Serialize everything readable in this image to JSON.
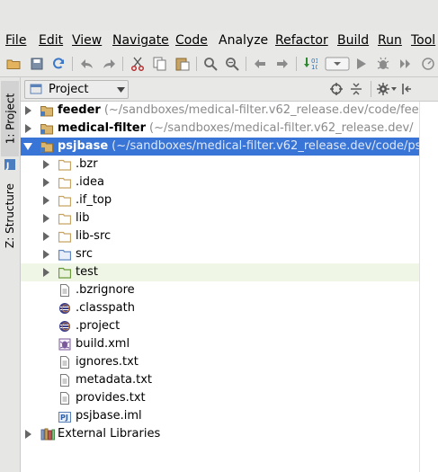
{
  "menu": [
    {
      "label": "File",
      "key": "file"
    },
    {
      "label": "Edit",
      "key": "edit"
    },
    {
      "label": "View",
      "key": "view"
    },
    {
      "label": "Navigate",
      "key": "navigate"
    },
    {
      "label": "Code",
      "key": "code"
    },
    {
      "label": "Analyze",
      "key": "analyze"
    },
    {
      "label": "Refactor",
      "key": "refactor"
    },
    {
      "label": "Build",
      "key": "build"
    },
    {
      "label": "Run",
      "key": "run"
    },
    {
      "label": "Tool",
      "key": "tools"
    }
  ],
  "toolbar": {
    "icons": [
      "open-folder-icon",
      "save-icon",
      "sync-icon",
      "undo-icon",
      "redo-icon",
      "cut-icon",
      "copy-icon",
      "paste-icon",
      "find-icon",
      "replace-icon",
      "back-icon",
      "forward-icon",
      "build-icon",
      "run-config-dropdown-icon",
      "run-icon",
      "debug-icon",
      "coverage-icon"
    ]
  },
  "sidebar": {
    "tabs": [
      {
        "label": "1: Project",
        "active": true
      },
      {
        "label": "Z: Structure",
        "active": false
      }
    ]
  },
  "panel": {
    "view_selector": "Project"
  },
  "tree": [
    {
      "label": "feeder",
      "path": "(~/sandboxes/medical-filter.v62_release.dev/code/fee",
      "level": 0,
      "arrow": "right",
      "icon": "module-folder-icon",
      "bold": true
    },
    {
      "label": "medical-filter",
      "path": "(~/sandboxes/medical-filter.v62_release.dev/",
      "level": 0,
      "arrow": "right",
      "icon": "module-folder-icon",
      "bold": true
    },
    {
      "label": "psjbase",
      "path": "(~/sandboxes/medical-filter.v62_release.dev/code/ps",
      "level": 0,
      "arrow": "down",
      "icon": "module-folder-icon",
      "bold": true,
      "selected": true
    },
    {
      "label": ".bzr",
      "level": 1,
      "arrow": "right",
      "icon": "folder-icon"
    },
    {
      "label": ".idea",
      "level": 1,
      "arrow": "right",
      "icon": "folder-icon"
    },
    {
      "label": ".if_top",
      "level": 1,
      "arrow": "right",
      "icon": "folder-icon"
    },
    {
      "label": "lib",
      "level": 1,
      "arrow": "right",
      "icon": "folder-icon"
    },
    {
      "label": "lib-src",
      "level": 1,
      "arrow": "right",
      "icon": "folder-icon"
    },
    {
      "label": "src",
      "level": 1,
      "arrow": "right",
      "icon": "source-folder-icon"
    },
    {
      "label": "test",
      "level": 1,
      "arrow": "right",
      "icon": "test-folder-icon",
      "highlight": true
    },
    {
      "label": ".bzrignore",
      "level": 1,
      "icon": "text-file-icon"
    },
    {
      "label": ".classpath",
      "level": 1,
      "icon": "eclipse-file-icon"
    },
    {
      "label": ".project",
      "level": 1,
      "icon": "eclipse-file-icon"
    },
    {
      "label": "build.xml",
      "level": 1,
      "icon": "ant-file-icon"
    },
    {
      "label": "ignores.txt",
      "level": 1,
      "icon": "text-file-icon"
    },
    {
      "label": "metadata.txt",
      "level": 1,
      "icon": "text-file-icon"
    },
    {
      "label": "provides.txt",
      "level": 1,
      "icon": "text-file-icon"
    },
    {
      "label": "psjbase.iml",
      "level": 1,
      "icon": "iml-file-icon"
    },
    {
      "label": "External Libraries",
      "level": 0,
      "arrow": "right",
      "icon": "library-icon"
    }
  ],
  "colors": {
    "selection": "#3875d7",
    "highlight": "#eff6e6",
    "path_text": "#8a8a8a",
    "folder": "#c8a464",
    "source_folder": "#5f87c0",
    "test_folder": "#6a9a3a"
  }
}
